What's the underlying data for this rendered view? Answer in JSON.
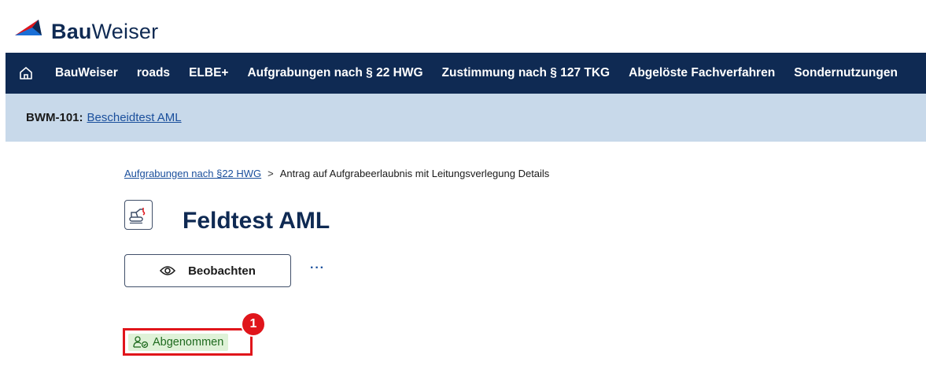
{
  "brand": {
    "name_bold": "Bau",
    "name_light": "Weiser",
    "colors": {
      "red": "#e0151b",
      "blue": "#1a6fd6",
      "navy": "#0f2a53"
    }
  },
  "nav": {
    "home_icon": "home-icon",
    "items": [
      "BauWeiser",
      "roads",
      "ELBE+",
      "Aufgrabungen nach § 22 HWG",
      "Zustimmung nach § 127 TKG",
      "Abgelöste Fachverfahren",
      "Sondernutzungen"
    ]
  },
  "context": {
    "id": "BWM-101:",
    "link": "Bescheidtest AML"
  },
  "breadcrumb": {
    "parent": "Aufgrabungen nach §22 HWG",
    "separator": ">",
    "current": "Antrag auf Aufgrabeerlaubnis mit Leitungsverlegung Details"
  },
  "page": {
    "title": "Feldtest AML",
    "title_icon": "excavator-icon"
  },
  "actions": {
    "watch_label": "Beobachten",
    "watch_icon": "eye-icon",
    "more_label": "···"
  },
  "status": {
    "label": "Abgenommen",
    "icon": "person-approved-icon",
    "color": "#1e6a1e",
    "background": "#dff2d8"
  },
  "annotation": {
    "marker": "1",
    "color": "#e0151b"
  }
}
